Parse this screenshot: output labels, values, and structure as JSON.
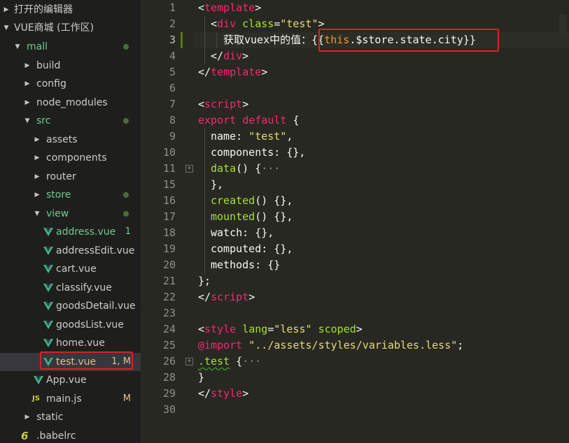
{
  "sidebar": {
    "open_editors": "打开的编辑器",
    "workspace": "VUE商城 (工作区)",
    "tree": [
      {
        "name": "mall",
        "indent": 1,
        "arrow": "down",
        "color": "green",
        "dot": true
      },
      {
        "name": "build",
        "indent": 2,
        "arrow": "right"
      },
      {
        "name": "config",
        "indent": 2,
        "arrow": "right"
      },
      {
        "name": "node_modules",
        "indent": 2,
        "arrow": "right"
      },
      {
        "name": "src",
        "indent": 2,
        "arrow": "down",
        "color": "green",
        "dot": true
      },
      {
        "name": "assets",
        "indent": 3,
        "arrow": "right"
      },
      {
        "name": "components",
        "indent": 3,
        "arrow": "right"
      },
      {
        "name": "router",
        "indent": 3,
        "arrow": "right"
      },
      {
        "name": "store",
        "indent": 3,
        "arrow": "right",
        "color": "green",
        "dot": true
      },
      {
        "name": "view",
        "indent": 3,
        "arrow": "down",
        "color": "green",
        "dot": true
      },
      {
        "name": "address.vue",
        "indent": 4,
        "icon": "vue",
        "color": "green",
        "badge": "1"
      },
      {
        "name": "addressEdit.vue",
        "indent": 4,
        "icon": "vue"
      },
      {
        "name": "cart.vue",
        "indent": 4,
        "icon": "vue"
      },
      {
        "name": "classify.vue",
        "indent": 4,
        "icon": "vue"
      },
      {
        "name": "goodsDetail.vue",
        "indent": 4,
        "icon": "vue"
      },
      {
        "name": "goodsList.vue",
        "indent": 4,
        "icon": "vue"
      },
      {
        "name": "home.vue",
        "indent": 4,
        "icon": "vue"
      },
      {
        "name": "test.vue",
        "indent": 4,
        "icon": "vue",
        "color": "modified",
        "badge": "1, M",
        "selected": true
      },
      {
        "name": "App.vue",
        "indent": 3,
        "icon": "vue"
      },
      {
        "name": "main.js",
        "indent": 3,
        "icon": "js",
        "badge": "M",
        "badge_color": "modified"
      },
      {
        "name": "static",
        "indent": 2,
        "arrow": "right"
      },
      {
        "name": ".babelrc",
        "indent": 2,
        "icon": "babel"
      }
    ],
    "js_icon_text": "JS",
    "babel_icon_text": "6"
  },
  "editor": {
    "line_numbers": [
      "1",
      "2",
      "3",
      "4",
      "5",
      "6",
      "7",
      "8",
      "9",
      "10",
      "11",
      "15",
      "16",
      "17",
      "18",
      "19",
      "20",
      "21",
      "22",
      "23",
      "24",
      "25",
      "26",
      "28",
      "29",
      "30"
    ],
    "fold_lines": [
      "11",
      "26"
    ],
    "code": {
      "l1_lt": "<",
      "l1_tag": "template",
      "l1_gt": ">",
      "l2_lt": "<",
      "l2_tag": "div",
      "l2_attr": "class",
      "l2_eq": "=",
      "l2_str": "\"test\"",
      "l2_gt": ">",
      "l3_text": "获取vuex中的值：",
      "l3_open": "{{",
      "l3_this": "this",
      "l3_rest": ".$store.state.city",
      "l3_close": "}}",
      "l4_lt": "</",
      "l4_tag": "div",
      "l4_gt": ">",
      "l5_lt": "</",
      "l5_tag": "template",
      "l5_gt": ">",
      "l7_lt": "<",
      "l7_tag": "script",
      "l7_gt": ">",
      "l8_kw": "export default",
      "l8_brace": " {",
      "l9_key": "name: ",
      "l9_str": "\"test\"",
      "l9_end": ",",
      "l10": "components: {},",
      "l11_fn": "data",
      "l11_rest": "() {",
      "l11_ell": "···",
      "l15": "},",
      "l16_fn": "created",
      "l16_rest": "() {},",
      "l17_fn": "mounted",
      "l17_rest": "() {},",
      "l18": "watch: {},",
      "l19": "computed: {},",
      "l20": "methods: {}",
      "l21": "};",
      "l22_lt": "</",
      "l22_tag": "script",
      "l22_gt": ">",
      "l24_lt": "<",
      "l24_tag": "style",
      "l24_attr": "lang",
      "l24_eq": "=",
      "l24_str": "\"less\"",
      "l24_attr2": "scoped",
      "l24_gt": ">",
      "l25_kw": "@import",
      "l25_str": "\"../assets/styles/variables.less\"",
      "l25_end": ";",
      "l26_sel": ".test",
      "l26_rest": " {",
      "l26_ell": "···",
      "l28": "}",
      "l29_lt": "</",
      "l29_tag": "style",
      "l29_gt": ">"
    }
  },
  "colors": {
    "sidebar_bg": "#1e1f1c",
    "editor_bg": "#272822",
    "highlight_box": "#e02020",
    "vue_green": "#41b883"
  }
}
